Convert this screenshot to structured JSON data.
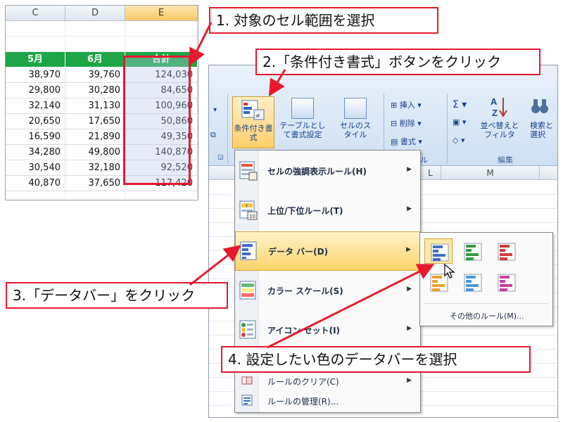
{
  "sheet": {
    "columns": [
      "C",
      "D",
      "E"
    ],
    "headers": [
      "5月",
      "6月",
      "合計"
    ],
    "rows": [
      [
        "38,970",
        "39,760",
        "124,030"
      ],
      [
        "29,800",
        "30,280",
        "84,650"
      ],
      [
        "32,140",
        "31,130",
        "100,960"
      ],
      [
        "20,650",
        "17,650",
        "50,860"
      ],
      [
        "16,590",
        "21,890",
        "49,350"
      ],
      [
        "34,280",
        "49,800",
        "140,870"
      ],
      [
        "30,540",
        "32,180",
        "92,520"
      ],
      [
        "40,870",
        "37,650",
        "117,420"
      ]
    ]
  },
  "ribbon": {
    "conditional_formatting": "条件付き書式",
    "format_as_table": "テーブルとして書式設定",
    "cell_styles": "セルのスタイル",
    "insert": "挿入",
    "delete": "削除",
    "format": "書式",
    "sort_filter": "並べ替えとフィルタ",
    "find_select": "検索と選択",
    "group_edit": "編集",
    "group_cells_tail": "ル"
  },
  "grid": {
    "columns": [
      "L",
      "M"
    ]
  },
  "menu": {
    "items": [
      {
        "label": "セルの強調表示ルール(H)"
      },
      {
        "label": "上位/下位ルール(T)"
      },
      {
        "label": "データ バー(D)"
      },
      {
        "label": "カラー スケール(S)"
      },
      {
        "label": "アイコン セット(I)"
      },
      {
        "label": "ルールのクリア(C)"
      },
      {
        "label": "ルールの管理(R)..."
      }
    ]
  },
  "submenu": {
    "colors": [
      "#3b6fc6",
      "#2e9d45",
      "#d23c3c",
      "#f0a029",
      "#4b98d9",
      "#c83fa6"
    ],
    "more_rules": "その他のルール(M)..."
  },
  "callouts": {
    "step1": "1. 対象のセル範囲を選択",
    "step2": "2.「条件付き書式」ボタンをクリック",
    "step3": "3.「データバー」をクリック",
    "step4": "4. 設定したい色のデータバーを選択"
  },
  "colors": {
    "accent": "#e8192c",
    "header_green": "#1ea548",
    "menu_highlight": "#ffd46a"
  }
}
